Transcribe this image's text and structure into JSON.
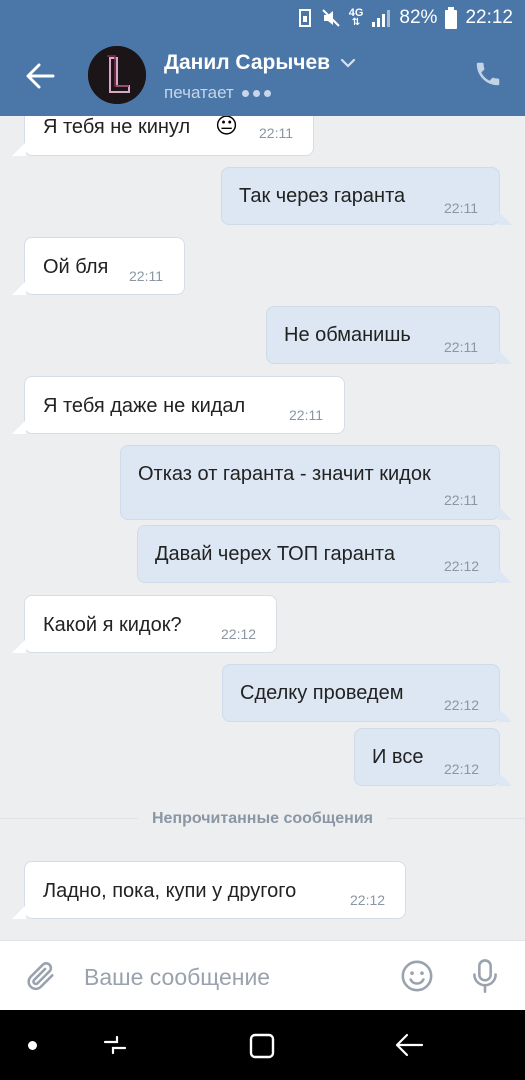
{
  "status_bar": {
    "battery_percent": "82%",
    "time": "22:12",
    "network": "4G",
    "icons": [
      "sim-saver-icon",
      "mute-icon",
      "network-4g-icon",
      "signal-icon",
      "battery-icon"
    ]
  },
  "header": {
    "contact_name": "Данил Сарычев",
    "status": "печатает",
    "icons": [
      "back-arrow-icon",
      "avatar",
      "chevron-down-icon",
      "phone-icon"
    ]
  },
  "colors": {
    "header_bg": "#4a76a8",
    "incoming_bg": "#ffffff",
    "outgoing_bg": "#dde7f3",
    "chat_bg": "#edeef0"
  },
  "messages": [
    {
      "dir": "in",
      "text": "Я тебя не кинул",
      "emoji": "😐",
      "time": "22:11"
    },
    {
      "dir": "out",
      "text": "Так через гаранта",
      "time": "22:11"
    },
    {
      "dir": "in",
      "text": "Ой бля",
      "time": "22:11"
    },
    {
      "dir": "out",
      "text": "Не обманишь",
      "time": "22:11"
    },
    {
      "dir": "in",
      "text": "Я тебя даже не кидал",
      "time": "22:11"
    },
    {
      "dir": "out",
      "text": "Отказ от гаранта - значит кидок",
      "time": "22:11"
    },
    {
      "dir": "out",
      "text": "Давай черех ТОП гаранта",
      "time": "22:12"
    },
    {
      "dir": "in",
      "text": "Какой я кидок?",
      "time": "22:12"
    },
    {
      "dir": "out",
      "text": "Сделку проведем",
      "time": "22:12"
    },
    {
      "dir": "out",
      "text": "И все",
      "time": "22:12"
    },
    {
      "dir": "in",
      "text": "Ладно, пока, купи у другого",
      "time": "22:12"
    }
  ],
  "unread_divider": "Непрочитанные сообщения",
  "composer": {
    "placeholder": "Ваше сообщение",
    "icons": [
      "paperclip-icon",
      "emoji-icon",
      "microphone-icon"
    ]
  },
  "nav_bar": {
    "icons": [
      "dot-icon",
      "recent-apps-icon",
      "home-icon",
      "back-icon"
    ]
  }
}
